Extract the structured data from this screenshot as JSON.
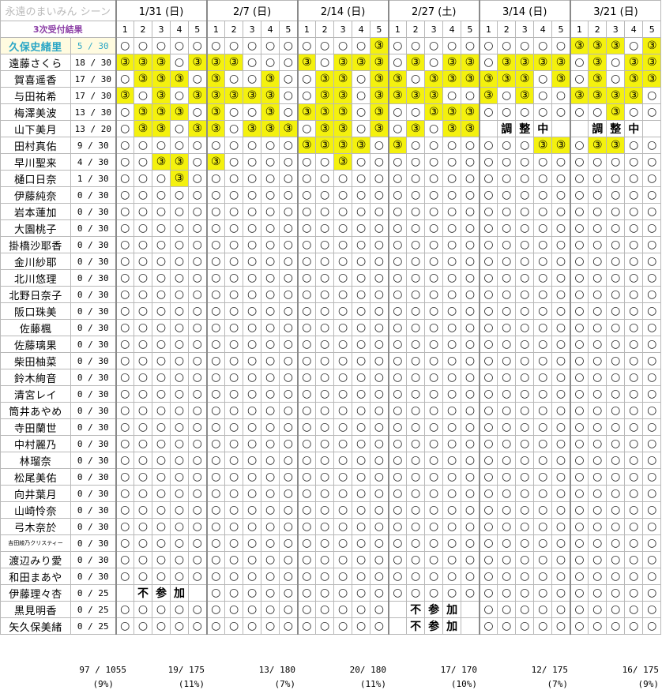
{
  "header": {
    "logo_text": "永遠のまいみん シーン",
    "title": "3次受付結果",
    "dates": [
      "1/31 (日)",
      "2/7 (日)",
      "2/14 (日)",
      "2/27 (土)",
      "3/14 (日)",
      "3/21 (日)"
    ],
    "slot_labels": [
      "1",
      "2",
      "3",
      "4",
      "5"
    ]
  },
  "legend": {
    "won_symbol": "③",
    "open_symbol": "○"
  },
  "colors": {
    "highlight_yellow": "#f4f10e",
    "title_purple": "#8c3fa6",
    "highlight_name": "#2aa6c6"
  },
  "members": [
    {
      "name": "久保史緒里",
      "score": " 5 / 30",
      "highlight": true,
      "slots": [
        "ooooo",
        "ooooo",
        "oooo3",
        "ooooo",
        "ooooo",
        "333o3"
      ]
    },
    {
      "name": "遠藤さくら",
      "score": "18 / 30",
      "slots": [
        "333o3",
        "33ooo",
        "3o333",
        "o3o33",
        "o3333",
        "o3o33"
      ]
    },
    {
      "name": "賀喜遥香",
      "score": "17 / 30",
      "slots": [
        "o333o",
        "3oo3o",
        "o33o3",
        "3o333",
        "333o3",
        "o3o33"
      ]
    },
    {
      "name": "与田祐希",
      "score": "17 / 30",
      "slots": [
        "3o3o3",
        "3333o",
        "o33o3",
        "333oo",
        "3o3oo",
        "3333o"
      ]
    },
    {
      "name": "梅澤美波",
      "score": "13 / 30",
      "slots": [
        "o333o",
        "3oo3o",
        "333o3",
        "oo333",
        "ooooo",
        "oo3oo"
      ]
    },
    {
      "name": "山下美月",
      "score": "13 / 20",
      "slots": [
        "o33o3",
        "3o333",
        "o33o3",
        "o3o33",
        "-----",
        "-----"
      ]
    },
    {
      "name": "田村真佑",
      "score": " 9 / 30",
      "slots": [
        "ooooo",
        "ooooo",
        "3333o",
        "3oooo",
        "ooo33",
        "o33oo"
      ]
    },
    {
      "name": "早川聖来",
      "score": " 4 / 30",
      "slots": [
        "oo33o",
        "3oooo",
        "oo3oo",
        "ooooo",
        "ooooo",
        "ooooo"
      ]
    },
    {
      "name": "樋口日奈",
      "score": " 1 / 30",
      "slots": [
        "ooo3o",
        "ooooo",
        "ooooo",
        "ooooo",
        "ooooo",
        "ooooo"
      ]
    },
    {
      "name": "伊藤純奈",
      "score": " 0 / 30",
      "slots": [
        "ooooo",
        "ooooo",
        "ooooo",
        "ooooo",
        "ooooo",
        "ooooo"
      ]
    },
    {
      "name": "岩本蓮加",
      "score": " 0 / 30",
      "slots": [
        "ooooo",
        "ooooo",
        "ooooo",
        "ooooo",
        "ooooo",
        "ooooo"
      ]
    },
    {
      "name": "大園桃子",
      "score": " 0 / 30",
      "slots": [
        "ooooo",
        "ooooo",
        "ooooo",
        "ooooo",
        "ooooo",
        "ooooo"
      ]
    },
    {
      "name": "掛橋沙耶香",
      "score": " 0 / 30",
      "slots": [
        "ooooo",
        "ooooo",
        "ooooo",
        "ooooo",
        "ooooo",
        "ooooo"
      ]
    },
    {
      "name": "金川紗耶",
      "score": " 0 / 30",
      "slots": [
        "ooooo",
        "ooooo",
        "ooooo",
        "ooooo",
        "ooooo",
        "ooooo"
      ]
    },
    {
      "name": "北川悠理",
      "score": " 0 / 30",
      "slots": [
        "ooooo",
        "ooooo",
        "ooooo",
        "ooooo",
        "ooooo",
        "ooooo"
      ]
    },
    {
      "name": "北野日奈子",
      "score": " 0 / 30",
      "slots": [
        "ooooo",
        "ooooo",
        "ooooo",
        "ooooo",
        "ooooo",
        "ooooo"
      ]
    },
    {
      "name": "阪口珠美",
      "score": " 0 / 30",
      "slots": [
        "ooooo",
        "ooooo",
        "ooooo",
        "ooooo",
        "ooooo",
        "ooooo"
      ]
    },
    {
      "name": "佐藤楓",
      "score": " 0 / 30",
      "slots": [
        "ooooo",
        "ooooo",
        "ooooo",
        "ooooo",
        "ooooo",
        "ooooo"
      ]
    },
    {
      "name": "佐藤璃果",
      "score": " 0 / 30",
      "slots": [
        "ooooo",
        "ooooo",
        "ooooo",
        "ooooo",
        "ooooo",
        "ooooo"
      ]
    },
    {
      "name": "柴田柚菜",
      "score": " 0 / 30",
      "slots": [
        "ooooo",
        "ooooo",
        "ooooo",
        "ooooo",
        "ooooo",
        "ooooo"
      ]
    },
    {
      "name": "鈴木絢音",
      "score": " 0 / 30",
      "slots": [
        "ooooo",
        "ooooo",
        "ooooo",
        "ooooo",
        "ooooo",
        "ooooo"
      ]
    },
    {
      "name": "清宮レイ",
      "score": " 0 / 30",
      "slots": [
        "ooooo",
        "ooooo",
        "ooooo",
        "ooooo",
        "ooooo",
        "ooooo"
      ]
    },
    {
      "name": "筒井あやめ",
      "score": " 0 / 30",
      "slots": [
        "ooooo",
        "ooooo",
        "ooooo",
        "ooooo",
        "ooooo",
        "ooooo"
      ]
    },
    {
      "name": "寺田蘭世",
      "score": " 0 / 30",
      "slots": [
        "ooooo",
        "ooooo",
        "ooooo",
        "ooooo",
        "ooooo",
        "ooooo"
      ]
    },
    {
      "name": "中村麗乃",
      "score": " 0 / 30",
      "slots": [
        "ooooo",
        "ooooo",
        "ooooo",
        "ooooo",
        "ooooo",
        "ooooo"
      ]
    },
    {
      "name": "林瑠奈",
      "score": " 0 / 30",
      "slots": [
        "ooooo",
        "ooooo",
        "ooooo",
        "ooooo",
        "ooooo",
        "ooooo"
      ]
    },
    {
      "name": "松尾美佑",
      "score": " 0 / 30",
      "slots": [
        "ooooo",
        "ooooo",
        "ooooo",
        "ooooo",
        "ooooo",
        "ooooo"
      ]
    },
    {
      "name": "向井葉月",
      "score": " 0 / 30",
      "slots": [
        "ooooo",
        "ooooo",
        "ooooo",
        "ooooo",
        "ooooo",
        "ooooo"
      ]
    },
    {
      "name": "山崎怜奈",
      "score": " 0 / 30",
      "slots": [
        "ooooo",
        "ooooo",
        "ooooo",
        "ooooo",
        "ooooo",
        "ooooo"
      ]
    },
    {
      "name": "弓木奈於",
      "score": " 0 / 30",
      "slots": [
        "ooooo",
        "ooooo",
        "ooooo",
        "ooooo",
        "ooooo",
        "ooooo"
      ]
    },
    {
      "name": "吉田綾乃クリスティー",
      "score": " 0 / 30",
      "small": true,
      "slots": [
        "ooooo",
        "ooooo",
        "ooooo",
        "ooooo",
        "ooooo",
        "ooooo"
      ]
    },
    {
      "name": "渡辺みり愛",
      "score": " 0 / 30",
      "slots": [
        "ooooo",
        "ooooo",
        "ooooo",
        "ooooo",
        "ooooo",
        "ooooo"
      ]
    },
    {
      "name": "和田まあや",
      "score": " 0 / 30",
      "slots": [
        "ooooo",
        "ooooo",
        "ooooo",
        "ooooo",
        "ooooo",
        "ooooo"
      ]
    },
    {
      "name": "伊藤理々杏",
      "score": " 0 / 25",
      "slots": [
        "-----",
        "ooooo",
        "ooooo",
        "ooooo",
        "ooooo",
        "ooooo"
      ]
    },
    {
      "name": "黒見明香",
      "score": " 0 / 25",
      "slots": [
        "ooooo",
        "ooooo",
        "ooooo",
        "-----",
        "ooooo",
        "ooooo"
      ]
    },
    {
      "name": "矢久保美緒",
      "score": " 0 / 25",
      "slots": [
        "ooooo",
        "ooooo",
        "ooooo",
        "-----",
        "ooooo",
        "ooooo"
      ]
    }
  ],
  "notes": [
    {
      "row": 5,
      "date": 4,
      "chars": [
        "調",
        "整",
        "中"
      ]
    },
    {
      "row": 5,
      "date": 5,
      "chars": [
        "調",
        "整",
        "中"
      ]
    },
    {
      "row": 33,
      "date": 0,
      "chars": [
        "不",
        "参",
        "加"
      ]
    },
    {
      "row": 34,
      "date": 3,
      "chars": [
        "不",
        "参",
        "加"
      ]
    },
    {
      "row": 35,
      "date": 3,
      "chars": [
        "不",
        "参",
        "加"
      ]
    }
  ],
  "footer": {
    "total": "97 / 1055",
    "total_pct": "(9%)",
    "per_date": [
      {
        "count": "19/ 175",
        "pct": "(11%)"
      },
      {
        "count": "13/ 180",
        "pct": "(7%)"
      },
      {
        "count": "20/ 180",
        "pct": "(11%)"
      },
      {
        "count": "17/ 170",
        "pct": "(10%)"
      },
      {
        "count": "12/ 175",
        "pct": "(7%)"
      },
      {
        "count": "16/ 175",
        "pct": "(9%)"
      }
    ]
  }
}
